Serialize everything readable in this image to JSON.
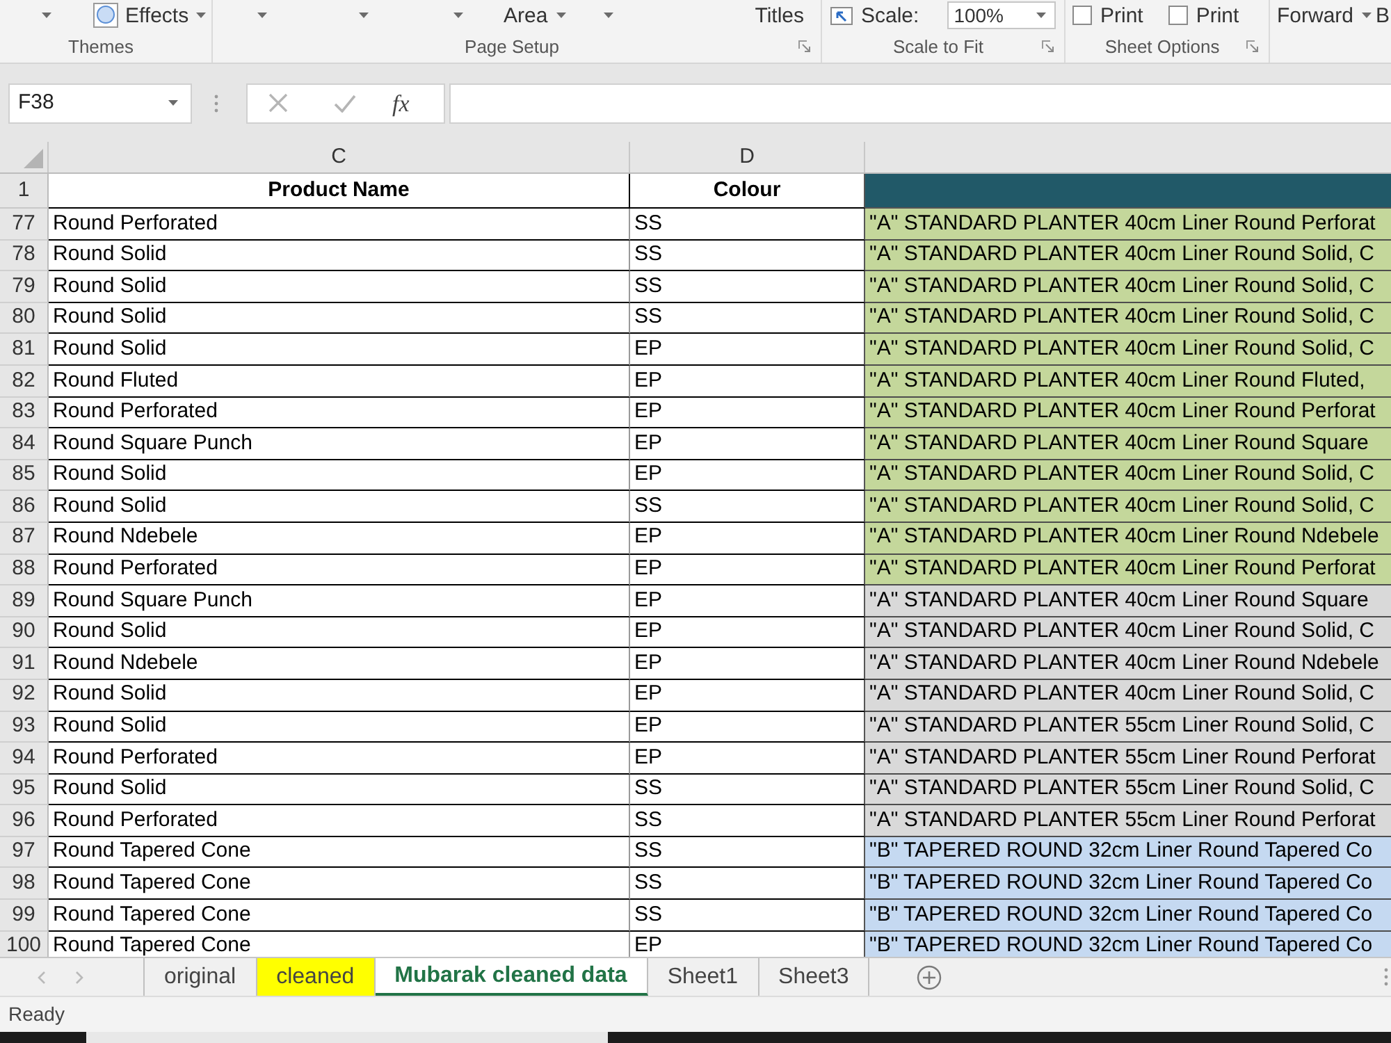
{
  "ribbon": {
    "groups": [
      {
        "label": "Themes",
        "controls": [
          {
            "kind": "caret"
          },
          {
            "kind": "icon-menu",
            "label": "Effects"
          }
        ]
      },
      {
        "label": "Page Setup",
        "launcher": true,
        "controls": [
          {
            "kind": "caret"
          },
          {
            "kind": "caret"
          },
          {
            "kind": "caret"
          },
          {
            "kind": "menu",
            "label": "Area"
          },
          {
            "kind": "caret"
          },
          {
            "kind": "button",
            "label": "Titles"
          }
        ]
      },
      {
        "label": "Scale to Fit",
        "launcher": true,
        "controls": [
          {
            "kind": "spin",
            "label": "Scale:",
            "value": "100%"
          }
        ]
      },
      {
        "label": "Sheet Options",
        "launcher": true,
        "controls": [
          {
            "kind": "checkbox",
            "label": "Print",
            "checked": false
          },
          {
            "kind": "checkbox",
            "label": "Print",
            "checked": false
          }
        ]
      },
      {
        "controls": [
          {
            "kind": "menu",
            "label": "Forward"
          },
          {
            "kind": "button",
            "label": "B"
          }
        ]
      }
    ]
  },
  "formula_bar": {
    "name_box": "F38",
    "function_button": "fx"
  },
  "sheet": {
    "columns": [
      {
        "letter": "C"
      },
      {
        "letter": "D"
      }
    ],
    "header_row": {
      "number": "1",
      "product_name": "Product Name",
      "colour": "Colour"
    },
    "rows": [
      {
        "number": "77",
        "product_name": "Round Perforated",
        "colour": "SS",
        "column_3": "\"A\" STANDARD PLANTER 40cm Liner Round Perforat",
        "color": "#c4d79b"
      },
      {
        "number": "78",
        "product_name": "Round Solid",
        "colour": "SS",
        "column_3": "\"A\" STANDARD PLANTER 40cm Liner Round Solid, C",
        "color": "#c4d79b"
      },
      {
        "number": "79",
        "product_name": "Round Solid",
        "colour": "SS",
        "column_3": "\"A\" STANDARD PLANTER 40cm Liner Round Solid, C",
        "color": "#c4d79b"
      },
      {
        "number": "80",
        "product_name": "Round Solid",
        "colour": "SS",
        "column_3": "\"A\" STANDARD PLANTER 40cm Liner Round Solid, C",
        "color": "#c4d79b"
      },
      {
        "number": "81",
        "product_name": "Round Solid",
        "colour": "EP",
        "column_3": "\"A\" STANDARD PLANTER 40cm Liner Round Solid, C",
        "color": "#c4d79b"
      },
      {
        "number": "82",
        "product_name": "Round Fluted",
        "colour": "EP",
        "column_3": "\"A\" STANDARD PLANTER 40cm Liner Round Fluted,",
        "color": "#c4d79b"
      },
      {
        "number": "83",
        "product_name": "Round Perforated",
        "colour": "EP",
        "column_3": "\"A\" STANDARD PLANTER 40cm Liner Round Perforat",
        "color": "#c4d79b"
      },
      {
        "number": "84",
        "product_name": "Round Square Punch",
        "colour": "EP",
        "column_3": "\"A\" STANDARD PLANTER 40cm Liner Round Square",
        "color": "#c4d79b"
      },
      {
        "number": "85",
        "product_name": "Round Solid",
        "colour": "EP",
        "column_3": "\"A\" STANDARD PLANTER 40cm Liner Round Solid, C",
        "color": "#c4d79b"
      },
      {
        "number": "86",
        "product_name": "Round Solid",
        "colour": "SS",
        "column_3": "\"A\" STANDARD PLANTER 40cm Liner Round Solid, C",
        "color": "#c4d79b"
      },
      {
        "number": "87",
        "product_name": "Round Ndebele",
        "colour": "EP",
        "column_3": "\"A\" STANDARD PLANTER 40cm Liner Round Ndebele",
        "color": "#c4d79b"
      },
      {
        "number": "88",
        "product_name": "Round Perforated",
        "colour": "EP",
        "column_3": "\"A\" STANDARD PLANTER 40cm Liner Round Perforat",
        "color": "#c4d79b"
      },
      {
        "number": "89",
        "product_name": "Round Square Punch",
        "colour": "EP",
        "column_3": "\"A\" STANDARD PLANTER 40cm Liner Round Square",
        "color": "#d9d9d9"
      },
      {
        "number": "90",
        "product_name": "Round Solid",
        "colour": "EP",
        "column_3": "\"A\" STANDARD PLANTER 40cm Liner Round Solid, C",
        "color": "#d9d9d9"
      },
      {
        "number": "91",
        "product_name": "Round Ndebele",
        "colour": "EP",
        "column_3": "\"A\" STANDARD PLANTER 40cm Liner Round Ndebele",
        "color": "#d9d9d9"
      },
      {
        "number": "92",
        "product_name": "Round Solid",
        "colour": "EP",
        "column_3": "\"A\" STANDARD PLANTER 40cm Liner Round Solid, C",
        "color": "#d9d9d9"
      },
      {
        "number": "93",
        "product_name": "Round Solid",
        "colour": "EP",
        "column_3": "\"A\" STANDARD PLANTER 55cm Liner Round Solid, C",
        "color": "#d9d9d9"
      },
      {
        "number": "94",
        "product_name": "Round Perforated",
        "colour": "EP",
        "column_3": "\"A\" STANDARD PLANTER 55cm Liner Round Perforat",
        "color": "#d9d9d9"
      },
      {
        "number": "95",
        "product_name": "Round Solid",
        "colour": "SS",
        "column_3": "\"A\" STANDARD PLANTER 55cm Liner Round Solid, C",
        "color": "#d9d9d9"
      },
      {
        "number": "96",
        "product_name": "Round Perforated",
        "colour": "SS",
        "column_3": "\"A\" STANDARD PLANTER 55cm Liner Round Perforat",
        "color": "#d9d9d9"
      },
      {
        "number": "97",
        "product_name": "Round Tapered Cone",
        "colour": "SS",
        "column_3": "\"B\" TAPERED ROUND 32cm Liner Round Tapered Co",
        "color": "#c5d9f1"
      },
      {
        "number": "98",
        "product_name": "Round Tapered Cone",
        "colour": "SS",
        "column_3": "\"B\" TAPERED ROUND 32cm Liner Round Tapered Co",
        "color": "#c5d9f1"
      },
      {
        "number": "99",
        "product_name": "Round Tapered Cone",
        "colour": "SS",
        "column_3": "\"B\" TAPERED ROUND 32cm Liner Round Tapered Co",
        "color": "#c5d9f1"
      },
      {
        "number": "100",
        "product_name": "Round Tapered Cone",
        "colour": "EP",
        "column_3": "\"B\" TAPERED ROUND 32cm Liner Round Tapered Co",
        "color": "#c5d9f1"
      }
    ]
  },
  "sheet_tabs": [
    {
      "label": "original",
      "selected": false
    },
    {
      "label": "cleaned",
      "selected": false,
      "color": "#ffff00"
    },
    {
      "label": "Mubarak cleaned data",
      "selected": true
    },
    {
      "label": "Sheet1",
      "selected": false
    },
    {
      "label": "Sheet3",
      "selected": false
    }
  ],
  "status_bar": {
    "text": "Ready"
  }
}
